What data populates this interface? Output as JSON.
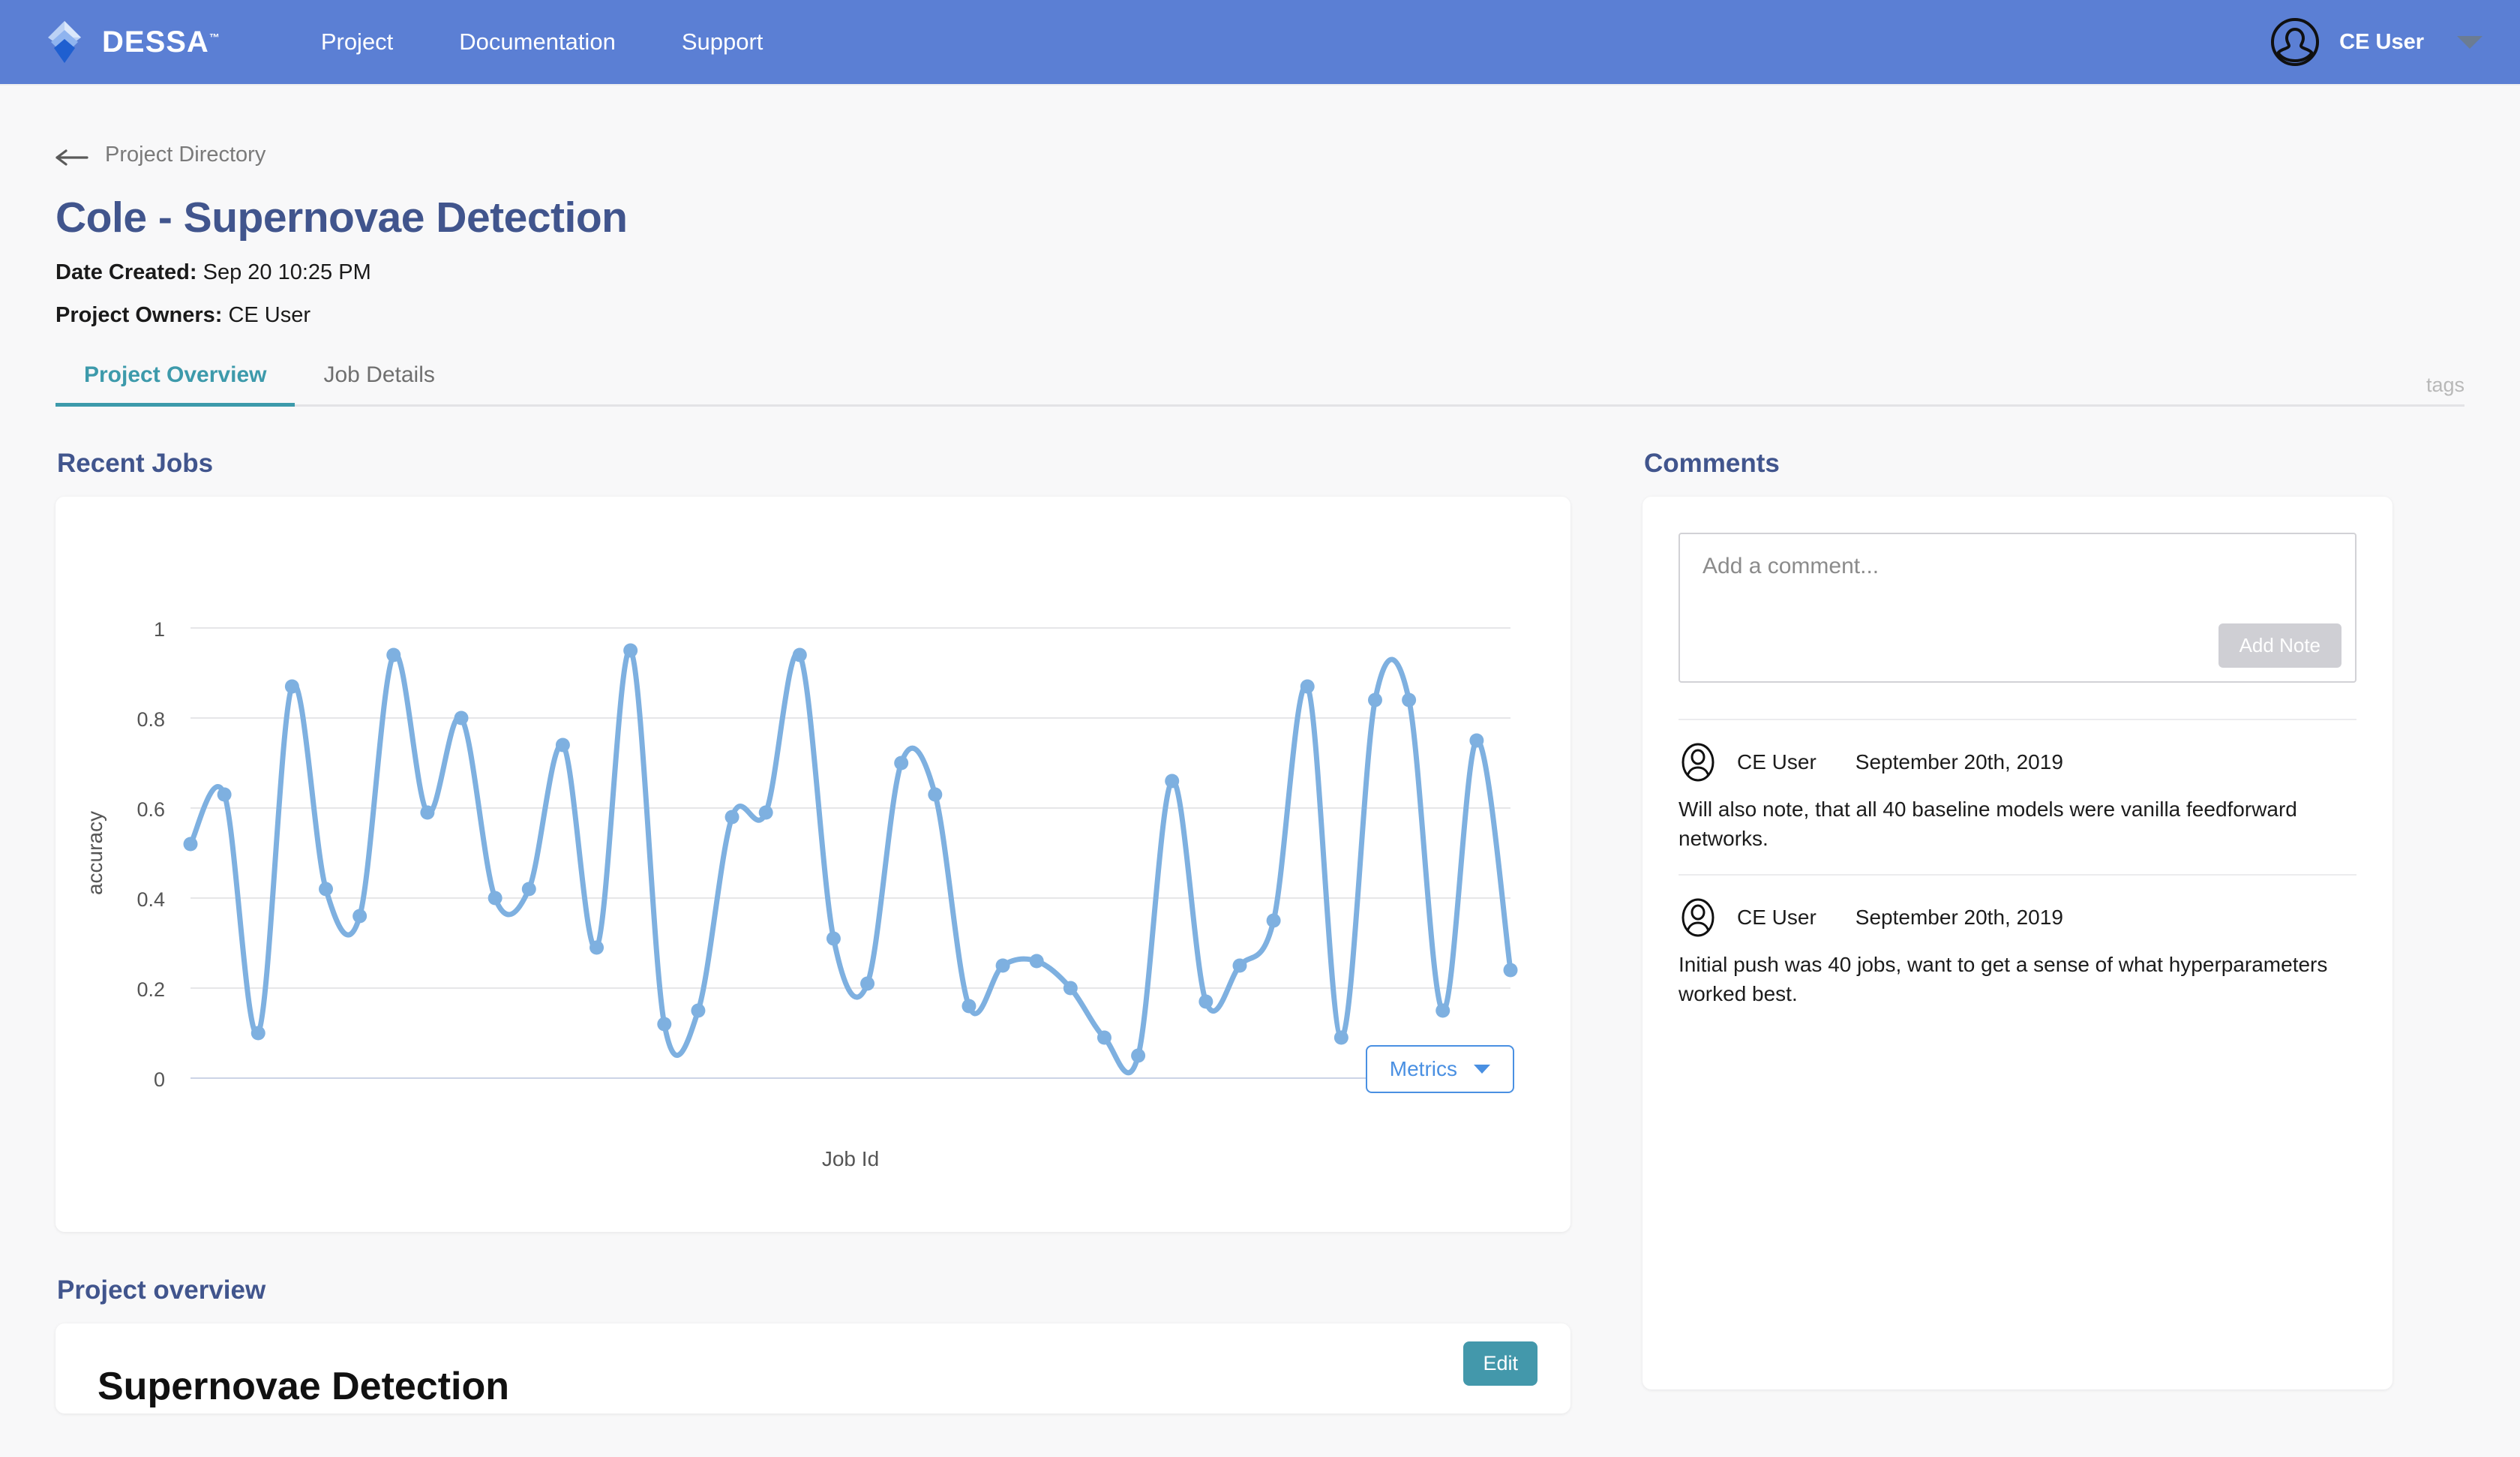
{
  "topbar": {
    "brand": "DESSA",
    "brand_tm": "™",
    "nav": [
      {
        "label": "Project"
      },
      {
        "label": "Documentation"
      },
      {
        "label": "Support"
      }
    ],
    "user_name": "CE User",
    "avatar_icon": "user-avatar-icon",
    "caret_icon": "chevron-down-icon",
    "bg_color": "#5b7fd4"
  },
  "breadcrumb": {
    "label": "Project Directory",
    "icon": "arrow-left-icon"
  },
  "header": {
    "title": "Cole - Supernovae Detection",
    "tags_label": "tags",
    "date_created_label": "Date Created:",
    "date_created_value": "Sep 20 10:25 PM",
    "project_owners_label": "Project Owners:",
    "project_owners_value": "CE User",
    "title_color": "#41558d"
  },
  "tabs": [
    {
      "label": "Project Overview",
      "active": true
    },
    {
      "label": "Job Details",
      "active": false
    }
  ],
  "tab_accent_color": "#3d9aab",
  "recent_jobs": {
    "heading": "Recent Jobs",
    "metrics_button": "Metrics",
    "metrics_caret_icon": "chevron-down-icon"
  },
  "comments": {
    "heading": "Comments",
    "input_placeholder": "Add a comment...",
    "add_note_button": "Add Note",
    "items": [
      {
        "avatar_icon": "user-avatar-icon",
        "author": "CE User",
        "date": "September 20th, 2019",
        "text": "Will also note, that all 40 baseline models were vanilla feedforward networks."
      },
      {
        "avatar_icon": "user-avatar-icon",
        "author": "CE User",
        "date": "September 20th, 2019",
        "text": "Initial push was 40 jobs, want to get a sense of what hyperparameters worked best."
      }
    ]
  },
  "project_overview": {
    "heading": "Project overview",
    "card_title": "Supernovae Detection",
    "edit_button": "Edit",
    "edit_button_color": "#4398ab"
  },
  "chart_data": {
    "type": "line",
    "title": "",
    "xlabel": "Job Id",
    "ylabel": "accuracy",
    "ylim": [
      0,
      1
    ],
    "yticks": [
      0,
      0.2,
      0.4,
      0.6,
      0.8,
      1
    ],
    "ytick_labels": [
      "0",
      "0.2",
      "0.4",
      "0.6",
      "0.8",
      "1"
    ],
    "xticks": [],
    "xtick_labels": [],
    "grid": true,
    "legend": false,
    "line_color": "#7eb0e0",
    "marker_color": "#7eb0e0",
    "series": [
      {
        "name": "accuracy",
        "values": [
          0.52,
          0.63,
          0.1,
          0.87,
          0.42,
          0.36,
          0.94,
          0.59,
          0.8,
          0.4,
          0.42,
          0.74,
          0.29,
          0.95,
          0.12,
          0.15,
          0.58,
          0.59,
          0.94,
          0.31,
          0.21,
          0.7,
          0.63,
          0.16,
          0.25,
          0.26,
          0.2,
          0.09,
          0.05,
          0.66,
          0.17,
          0.25,
          0.35,
          0.87,
          0.09,
          0.84,
          0.84,
          0.15,
          0.75,
          0.24
        ]
      }
    ]
  }
}
